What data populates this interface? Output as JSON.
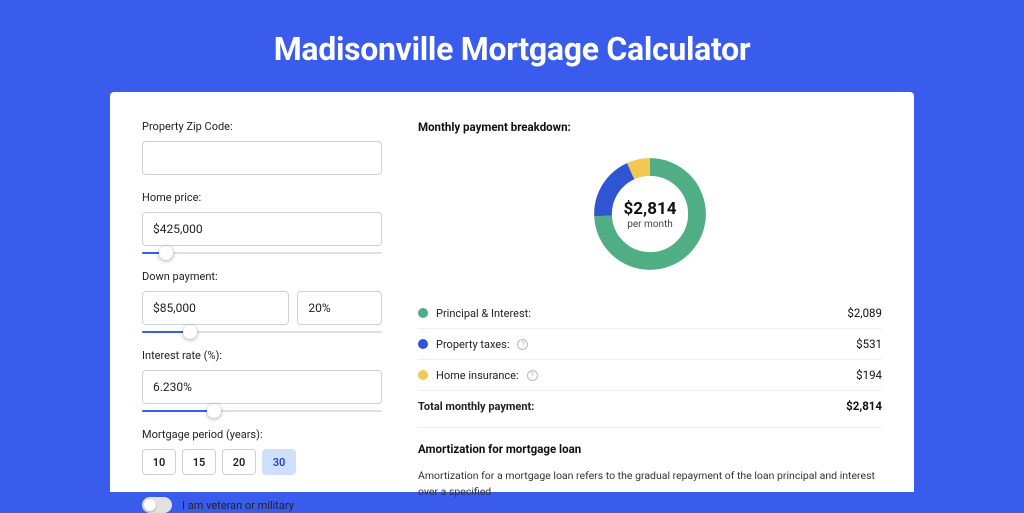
{
  "title": "Madisonville Mortgage Calculator",
  "form": {
    "zip": {
      "label": "Property Zip Code:",
      "value": ""
    },
    "homePrice": {
      "label": "Home price:",
      "value": "$425,000",
      "sliderPct": 10
    },
    "downPayment": {
      "label": "Down payment:",
      "amount": "$85,000",
      "pct": "20%",
      "sliderPct": 20
    },
    "interestRate": {
      "label": "Interest rate (%):",
      "value": "6.230%",
      "sliderPct": 30
    },
    "period": {
      "label": "Mortgage period (years):",
      "options": [
        "10",
        "15",
        "20",
        "30"
      ],
      "selected": "30"
    },
    "veteran": {
      "label": "I am veteran or military",
      "checked": false
    }
  },
  "breakdown": {
    "title": "Monthly payment breakdown:",
    "center": {
      "amount": "$2,814",
      "sub": "per month"
    },
    "items": [
      {
        "label": "Principal & Interest:",
        "value": "$2,089",
        "color": "#4fae84",
        "info": false
      },
      {
        "label": "Property taxes:",
        "value": "$531",
        "color": "#2f55d4",
        "info": true
      },
      {
        "label": "Home insurance:",
        "value": "$194",
        "color": "#f3c752",
        "info": true
      }
    ],
    "total": {
      "label": "Total monthly payment:",
      "value": "$2,814"
    }
  },
  "chart_data": {
    "type": "pie",
    "title": "Monthly payment breakdown:",
    "series": [
      {
        "name": "Principal & Interest",
        "value": 2089,
        "color": "#4fae84"
      },
      {
        "name": "Property taxes",
        "value": 531,
        "color": "#2f55d4"
      },
      {
        "name": "Home insurance",
        "value": 194,
        "color": "#f3c752"
      }
    ],
    "total": 2814,
    "center_label": "$2,814 per month"
  },
  "amortization": {
    "title": "Amortization for mortgage loan",
    "body": "Amortization for a mortgage loan refers to the gradual repayment of the loan principal and interest over a specified"
  }
}
